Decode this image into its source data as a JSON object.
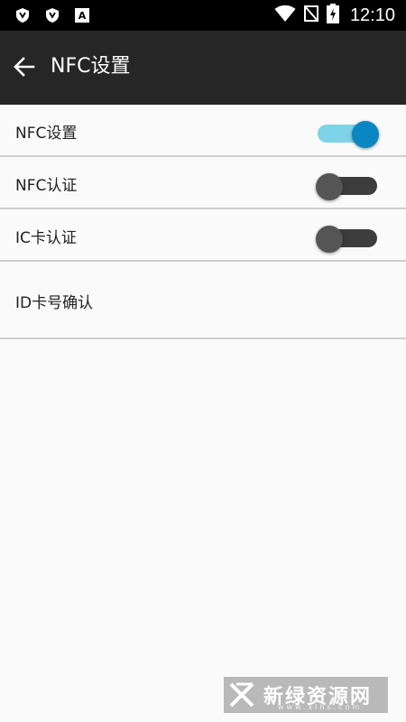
{
  "status_bar": {
    "time": "12:10",
    "notification_icons": [
      "shield-icon",
      "shield-icon",
      "a-icon"
    ],
    "system_icons": [
      "wifi-icon",
      "no-signal-icon",
      "battery-charging-icon"
    ]
  },
  "app_bar": {
    "title": "NFC设置",
    "back_icon": "arrow-left-icon"
  },
  "settings": [
    {
      "label": "NFC设置",
      "switch_on": true
    },
    {
      "label": "NFC认证",
      "switch_on": false
    },
    {
      "label": "IC卡认证",
      "switch_on": false
    },
    {
      "label": "ID卡号确认"
    }
  ],
  "colors": {
    "app_bar": "#262626",
    "switch_on_thumb": "#0a87c2",
    "switch_on_track": "#7fd3e8",
    "switch_off_thumb": "#555555",
    "switch_off_track": "#3d3d3d"
  },
  "watermark": {
    "text": "新绿资源网",
    "sub": "www.xlhs.com"
  }
}
